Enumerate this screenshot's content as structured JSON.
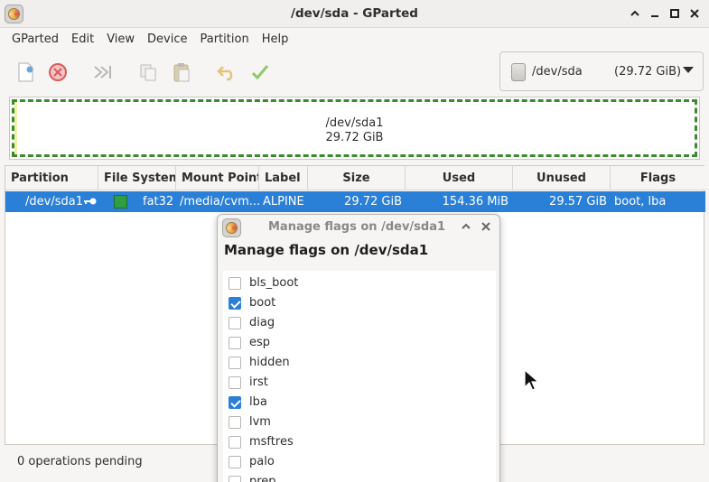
{
  "window": {
    "title": "/dev/sda - GParted"
  },
  "menu": [
    "GParted",
    "Edit",
    "View",
    "Device",
    "Partition",
    "Help"
  ],
  "toolbar": {
    "icons": [
      "new-icon",
      "delete-icon",
      "resize-move-icon",
      "copy-icon",
      "paste-icon",
      "undo-icon",
      "apply-icon"
    ]
  },
  "device": {
    "name": "/dev/sda",
    "size": "(29.72 GiB)"
  },
  "diskmap": {
    "partition": "/dev/sda1",
    "size": "29.72 GiB"
  },
  "table": {
    "headers": [
      "Partition",
      "File System",
      "Mount Point",
      "Label",
      "Size",
      "Used",
      "Unused",
      "Flags"
    ],
    "row": {
      "partition": "/dev/sda1",
      "filesystem": "fat32",
      "mount": "/media/cvm...",
      "label": "ALPINE",
      "size": "29.72 GiB",
      "used": "154.36 MiB",
      "unused": "29.57 GiB",
      "flags": "boot, lba",
      "fs_color": "#2f9e41"
    }
  },
  "status": {
    "text": "0 operations pending"
  },
  "dialog": {
    "title": "Manage flags on /dev/sda1",
    "heading": "Manage flags on /dev/sda1",
    "flags": [
      {
        "label": "bls_boot",
        "checked": false
      },
      {
        "label": "boot",
        "checked": true
      },
      {
        "label": "diag",
        "checked": false
      },
      {
        "label": "esp",
        "checked": false
      },
      {
        "label": "hidden",
        "checked": false
      },
      {
        "label": "irst",
        "checked": false
      },
      {
        "label": "lba",
        "checked": true
      },
      {
        "label": "lvm",
        "checked": false
      },
      {
        "label": "msftres",
        "checked": false
      },
      {
        "label": "palo",
        "checked": false
      },
      {
        "label": "prep",
        "checked": false
      }
    ]
  },
  "colors": {
    "selection": "#2a7fd6",
    "partition_border": "#3c8a2e"
  }
}
